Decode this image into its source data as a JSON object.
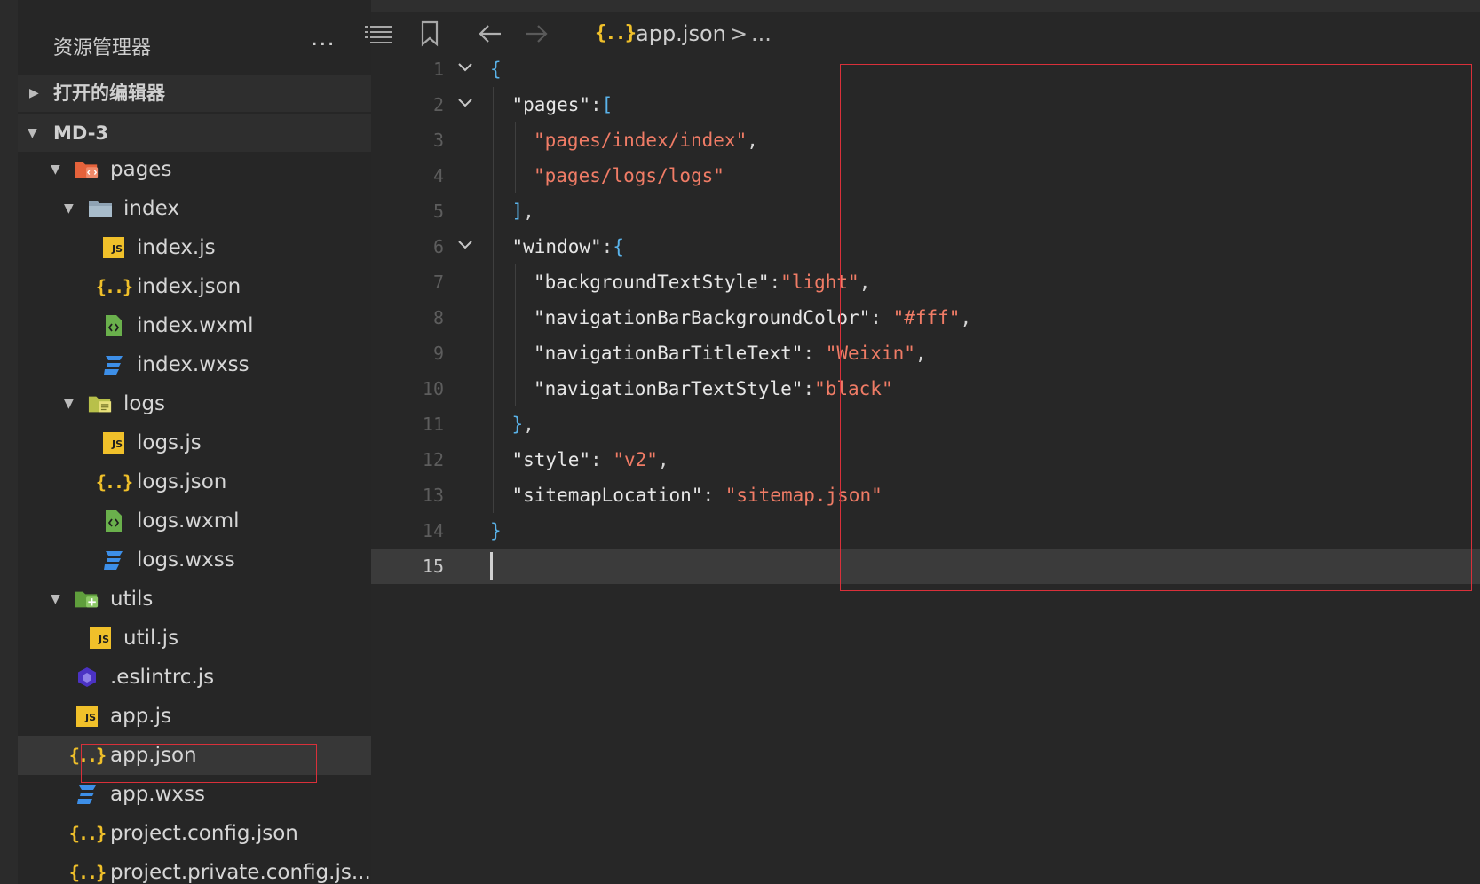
{
  "explorer": {
    "title": "资源管理器",
    "more": "...",
    "open_editors": "打开的编辑器",
    "project": "MD-3",
    "tree": [
      {
        "label": "pages",
        "icon": "pages-folder-icon",
        "depth": 0,
        "arrow": "▼",
        "kind": "folder"
      },
      {
        "label": "index",
        "icon": "folder-open-icon",
        "depth": 1,
        "arrow": "▼",
        "kind": "folder"
      },
      {
        "label": "index.js",
        "icon": "js-file-icon",
        "depth": 2,
        "kind": "js"
      },
      {
        "label": "index.json",
        "icon": "json-file-icon",
        "depth": 2,
        "kind": "json"
      },
      {
        "label": "index.wxml",
        "icon": "wxml-file-icon",
        "depth": 2,
        "kind": "wxml"
      },
      {
        "label": "index.wxss",
        "icon": "wxss-file-icon",
        "depth": 2,
        "kind": "wxss"
      },
      {
        "label": "logs",
        "icon": "logs-folder-icon",
        "depth": 1,
        "arrow": "▼",
        "kind": "logsfolder"
      },
      {
        "label": "logs.js",
        "icon": "js-file-icon",
        "depth": 2,
        "kind": "js"
      },
      {
        "label": "logs.json",
        "icon": "json-file-icon",
        "depth": 2,
        "kind": "json"
      },
      {
        "label": "logs.wxml",
        "icon": "wxml-file-icon",
        "depth": 2,
        "kind": "wxml"
      },
      {
        "label": "logs.wxss",
        "icon": "wxss-file-icon",
        "depth": 2,
        "kind": "wxss"
      },
      {
        "label": "utils",
        "icon": "utils-folder-icon",
        "depth": 0,
        "arrow": "▼",
        "kind": "utilsfolder"
      },
      {
        "label": "util.js",
        "icon": "js-file-icon",
        "depth": 1,
        "kind": "js"
      },
      {
        "label": ".eslintrc.js",
        "icon": "eslint-icon",
        "depth": 0,
        "kind": "eslint"
      },
      {
        "label": "app.js",
        "icon": "js-file-icon",
        "depth": 0,
        "kind": "js"
      },
      {
        "label": "app.json",
        "icon": "json-file-icon",
        "depth": 0,
        "kind": "json",
        "selected": true
      },
      {
        "label": "app.wxss",
        "icon": "wxss-file-icon",
        "depth": 0,
        "kind": "wxss"
      },
      {
        "label": "project.config.json",
        "icon": "json-file-icon",
        "depth": 0,
        "kind": "json"
      },
      {
        "label": "project.private.config.js...",
        "icon": "json-file-icon",
        "depth": 0,
        "kind": "json"
      }
    ]
  },
  "toolbar": {
    "breadcrumb_icon": "{..}",
    "breadcrumb_file": "app.json",
    "breadcrumb_sep": ">",
    "breadcrumb_more": "..."
  },
  "editor": {
    "active_line": 15,
    "lines": [
      {
        "n": "1",
        "indent": 0,
        "fold": true,
        "tokens": [
          [
            "{",
            "br"
          ]
        ]
      },
      {
        "n": "2",
        "indent": 1,
        "fold": true,
        "tokens": [
          [
            "\"pages\"",
            "key"
          ],
          [
            ":",
            "pun"
          ],
          [
            "[",
            "br"
          ]
        ]
      },
      {
        "n": "3",
        "indent": 2,
        "tokens": [
          [
            "\"pages/index/index\"",
            "str"
          ],
          [
            ",",
            "pun"
          ]
        ]
      },
      {
        "n": "4",
        "indent": 2,
        "tokens": [
          [
            "\"pages/logs/logs\"",
            "str"
          ]
        ]
      },
      {
        "n": "5",
        "indent": 1,
        "tokens": [
          [
            "]",
            "br"
          ],
          [
            ",",
            "pun"
          ]
        ]
      },
      {
        "n": "6",
        "indent": 1,
        "fold": true,
        "tokens": [
          [
            "\"window\"",
            "key"
          ],
          [
            ":",
            "pun"
          ],
          [
            "{",
            "br"
          ]
        ]
      },
      {
        "n": "7",
        "indent": 2,
        "tokens": [
          [
            "\"backgroundTextStyle\"",
            "key"
          ],
          [
            ":",
            "pun"
          ],
          [
            "\"light\"",
            "str"
          ],
          [
            ",",
            "pun"
          ]
        ]
      },
      {
        "n": "8",
        "indent": 2,
        "tokens": [
          [
            "\"navigationBarBackgroundColor\"",
            "key"
          ],
          [
            ": ",
            "pun"
          ],
          [
            "\"#fff\"",
            "str"
          ],
          [
            ",",
            "pun"
          ]
        ]
      },
      {
        "n": "9",
        "indent": 2,
        "tokens": [
          [
            "\"navigationBarTitleText\"",
            "key"
          ],
          [
            ": ",
            "pun"
          ],
          [
            "\"Weixin\"",
            "str"
          ],
          [
            ",",
            "pun"
          ]
        ]
      },
      {
        "n": "10",
        "indent": 2,
        "tokens": [
          [
            "\"navigationBarTextStyle\"",
            "key"
          ],
          [
            ":",
            "pun"
          ],
          [
            "\"black\"",
            "str"
          ]
        ]
      },
      {
        "n": "11",
        "indent": 1,
        "tokens": [
          [
            "}",
            "br"
          ],
          [
            ",",
            "pun"
          ]
        ]
      },
      {
        "n": "12",
        "indent": 1,
        "tokens": [
          [
            "\"style\"",
            "key"
          ],
          [
            ": ",
            "pun"
          ],
          [
            "\"v2\"",
            "str"
          ],
          [
            ",",
            "pun"
          ]
        ]
      },
      {
        "n": "13",
        "indent": 1,
        "tokens": [
          [
            "\"sitemapLocation\"",
            "key"
          ],
          [
            ": ",
            "pun"
          ],
          [
            "\"sitemap.json\"",
            "str"
          ]
        ]
      },
      {
        "n": "14",
        "indent": 0,
        "tokens": [
          [
            "}",
            "br"
          ]
        ]
      },
      {
        "n": "15",
        "indent": 0,
        "tokens": []
      }
    ]
  },
  "colors": {
    "brace": "#5ab3ea",
    "key": "#e6e6e6",
    "string": "#f07c66",
    "highlight_border": "#d9303a",
    "js_icon": "#f0c02a",
    "wxss_icon": "#3d8fe8",
    "wxml_icon": "#6ab04c",
    "eslint_icon": "#4b32c3"
  }
}
